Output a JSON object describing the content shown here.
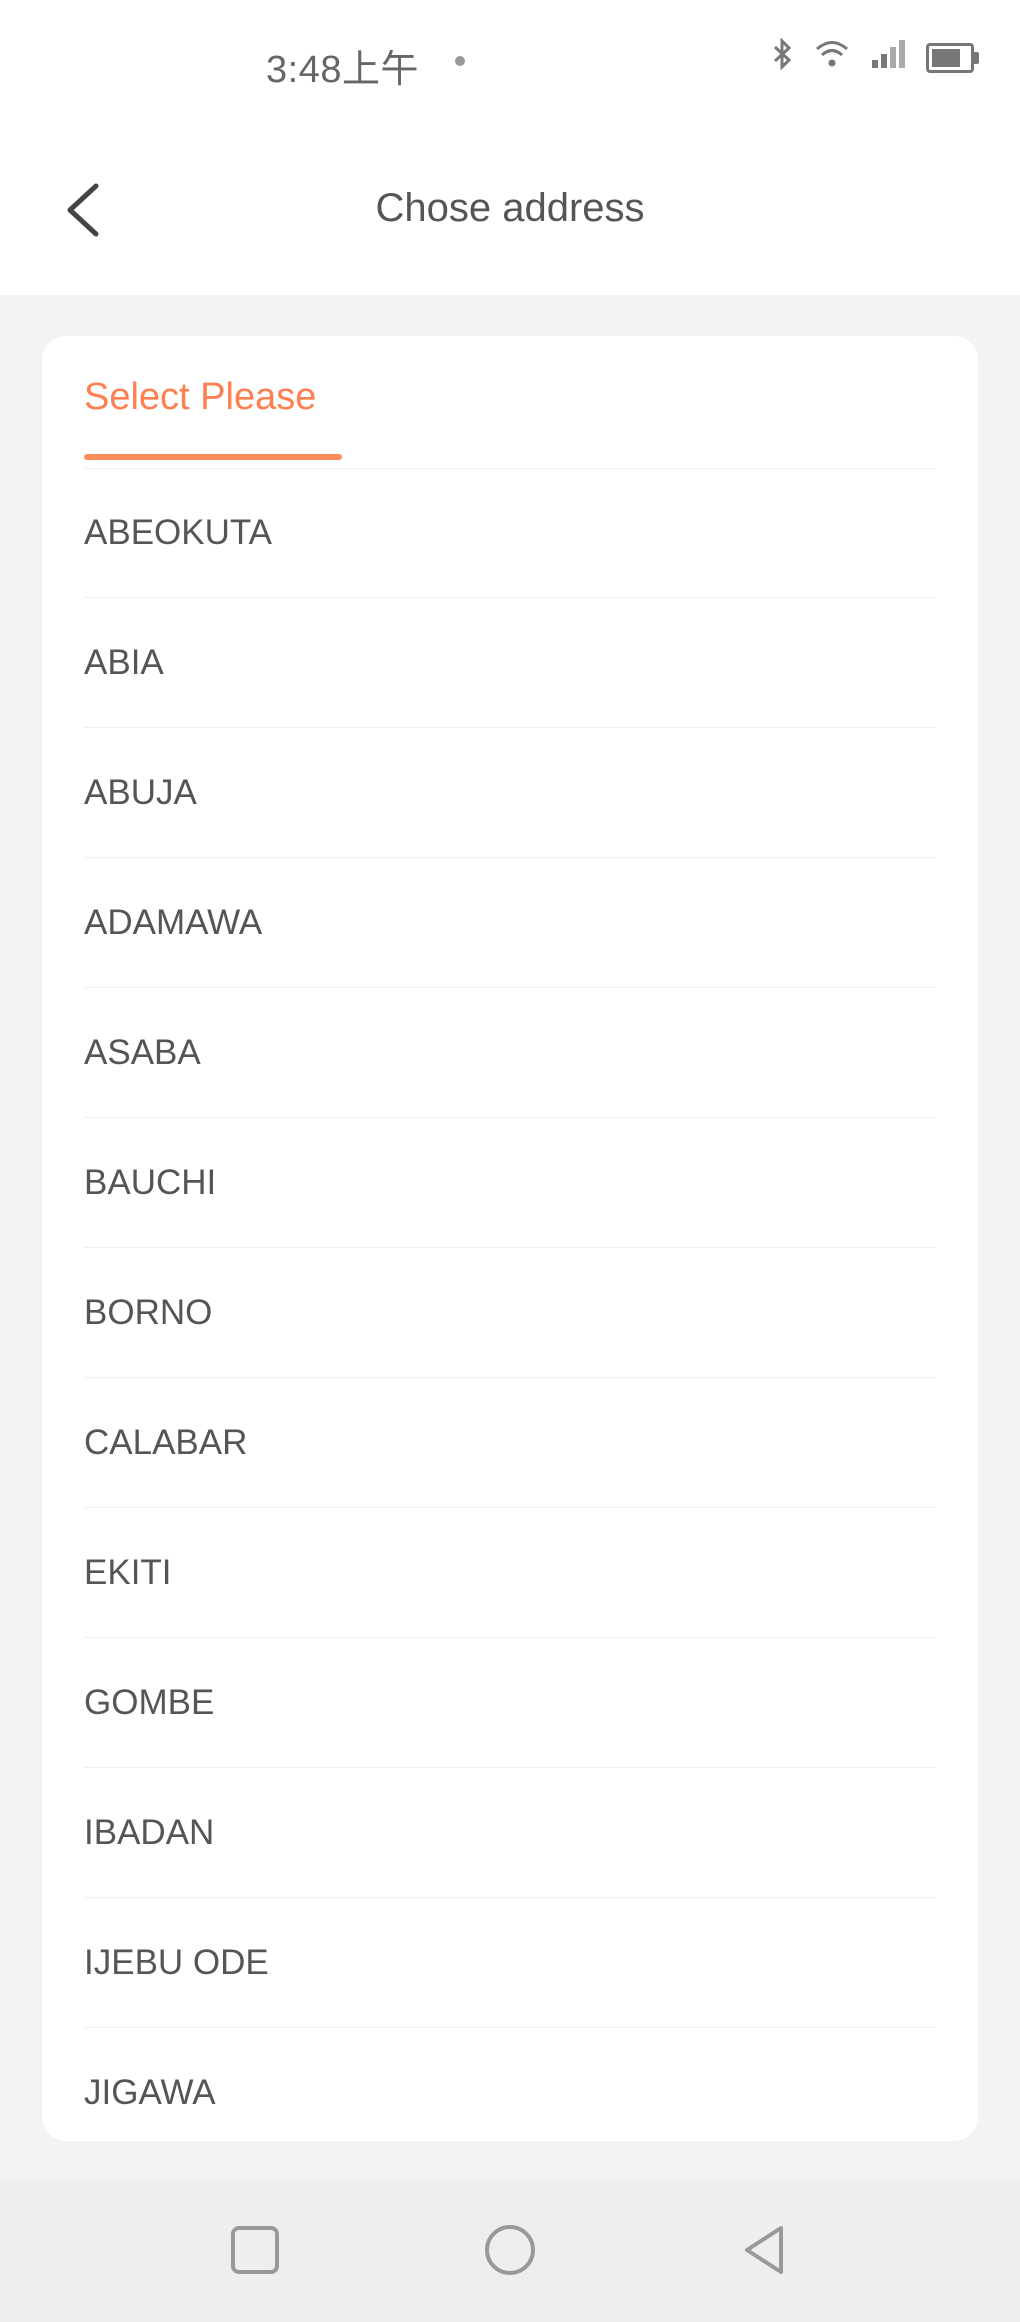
{
  "status_bar": {
    "time": "3:48上午"
  },
  "header": {
    "title": "Chose address"
  },
  "card": {
    "tab_label": "Select Please",
    "items": [
      "ABEOKUTA",
      "ABIA",
      "ABUJA",
      "ADAMAWA",
      "ASABA",
      "BAUCHI",
      "BORNO",
      "CALABAR",
      "EKITI",
      "GOMBE",
      "IBADAN",
      "IJEBU ODE",
      "JIGAWA"
    ]
  },
  "colors": {
    "accent": "#ff7f50",
    "text": "#555555",
    "background": "#f2f3f5"
  }
}
